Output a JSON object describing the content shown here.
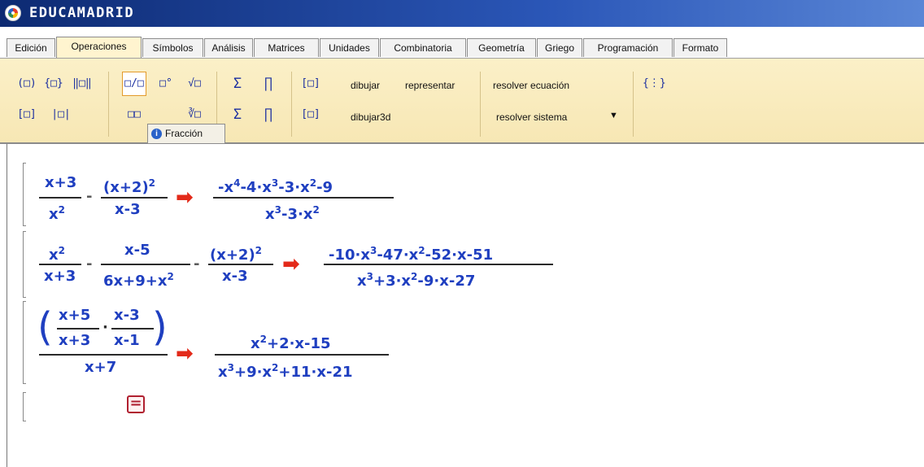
{
  "app": {
    "title": "EDUCAMADRID"
  },
  "tabs": [
    "Edición",
    "Operaciones",
    "Símbolos",
    "Análisis",
    "Matrices",
    "Unidades",
    "Combinatoria",
    "Geometría",
    "Griego",
    "Programación",
    "Formato"
  ],
  "active_tab": "Operaciones",
  "toolbar": {
    "buttons": {
      "paren": "(□)",
      "brace": "{□}",
      "norm": "‖□‖",
      "bracket": "[□]",
      "abs": "|□|",
      "fraction": "□/□",
      "degree": "□°",
      "sqrt": "√□",
      "sum": "Σ",
      "prod": "∏",
      "sum_limits": "Σ",
      "prod_limits": "∏",
      "floor1": "[□]",
      "floor2": "[□]",
      "subsup": "□□",
      "box": "□",
      "nroot": "∛□",
      "vector": "{⋮}"
    },
    "dibujar": "dibujar",
    "representar": "representar",
    "dibujar3d": "dibujar3d",
    "resolver_ecuacion": "resolver ecuación",
    "resolver_sistema": "resolver sistema",
    "dropdown_icon": "triangle-down-icon",
    "tooltip": "Fracción"
  },
  "math": {
    "arrow": "➡",
    "eq1": {
      "a_num": "x+3",
      "a_den": "x",
      "a_den_exp": "2",
      "minus": "-",
      "b_num": "(x+2)",
      "b_num_exp": "2",
      "b_den": "x-3",
      "res_num": [
        {
          "t": "-x",
          "e": "4"
        },
        {
          "t": "-4·x",
          "e": "3"
        },
        {
          "t": "-3·x",
          "e": "2"
        },
        {
          "t": "-9",
          "e": ""
        }
      ],
      "res_den": [
        {
          "t": "x",
          "e": "3"
        },
        {
          "t": "-3·x",
          "e": "2"
        }
      ]
    },
    "eq2": {
      "a_num": "x",
      "a_num_exp": "2",
      "a_den": "x+3",
      "b_num": "x-5",
      "b_den": "6x+9+x",
      "b_den_exp": "2",
      "c_num": "(x+2)",
      "c_num_exp": "2",
      "c_den": "x-3",
      "res_num": [
        {
          "t": "-10·x",
          "e": "3"
        },
        {
          "t": "-47·x",
          "e": "2"
        },
        {
          "t": "-52·x-51",
          "e": ""
        }
      ],
      "res_den": [
        {
          "t": "x",
          "e": "3"
        },
        {
          "t": "+3·x",
          "e": "2"
        },
        {
          "t": "-9·x-27",
          "e": ""
        }
      ]
    },
    "eq3": {
      "i_num": "x+5",
      "i_den": "x+3",
      "dot": "·",
      "j_num": "x-3",
      "j_den": "x-1",
      "den": "x+7",
      "res_num": [
        {
          "t": "x",
          "e": "2"
        },
        {
          "t": "+2·x-15",
          "e": ""
        }
      ],
      "res_den": [
        {
          "t": "x",
          "e": "3"
        },
        {
          "t": "+9·x",
          "e": "2"
        },
        {
          "t": "+11·x-21",
          "e": ""
        }
      ]
    },
    "equals_button": "="
  }
}
